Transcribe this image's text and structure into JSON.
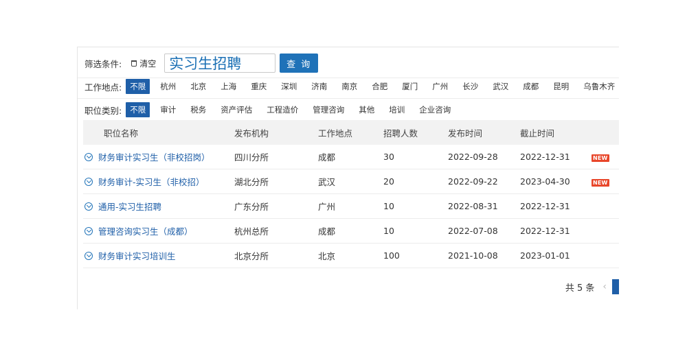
{
  "filters": {
    "label": "筛选条件:",
    "clear_label": "清空",
    "search_value": "实习生招聘",
    "search_button": "查 询",
    "location": {
      "label": "工作地点:",
      "options": [
        "不限",
        "杭州",
        "北京",
        "上海",
        "重庆",
        "深圳",
        "济南",
        "南京",
        "合肥",
        "厦门",
        "广州",
        "长沙",
        "武汉",
        "成都",
        "昆明",
        "乌鲁木齐"
      ],
      "active": "不限"
    },
    "category": {
      "label": "职位类别:",
      "options": [
        "不限",
        "审计",
        "税务",
        "资产评估",
        "工程造价",
        "管理咨询",
        "其他",
        "培训",
        "企业咨询"
      ],
      "active": "不限"
    }
  },
  "table": {
    "headers": [
      "职位名称",
      "发布机构",
      "工作地点",
      "招聘人数",
      "发布时间",
      "截止时间"
    ],
    "rows": [
      {
        "title": "财务审计实习生（非校招岗）",
        "org": "四川分所",
        "location": "成都",
        "count": "30",
        "publish": "2022-09-28",
        "deadline": "2022-12-31",
        "badge": "NEW"
      },
      {
        "title": "财务审计-实习生（非校招）",
        "org": "湖北分所",
        "location": "武汉",
        "count": "20",
        "publish": "2022-09-22",
        "deadline": "2023-04-30",
        "badge": "NEW"
      },
      {
        "title": "通用-实习生招聘",
        "org": "广东分所",
        "location": "广州",
        "count": "10",
        "publish": "2022-08-31",
        "deadline": "2022-12-31",
        "badge": ""
      },
      {
        "title": "管理咨询实习生（成都）",
        "org": "杭州总所",
        "location": "成都",
        "count": "10",
        "publish": "2022-07-08",
        "deadline": "2022-12-31",
        "badge": ""
      },
      {
        "title": "财务审计实习培训生",
        "org": "北京分所",
        "location": "北京",
        "count": "100",
        "publish": "2021-10-08",
        "deadline": "2023-01-01",
        "badge": ""
      }
    ]
  },
  "pagination": {
    "total_label": "共 5 条",
    "prev_icon": "chevron-left-icon"
  },
  "colors": {
    "accent": "#1f5fa8",
    "badge": "#e8462a"
  }
}
